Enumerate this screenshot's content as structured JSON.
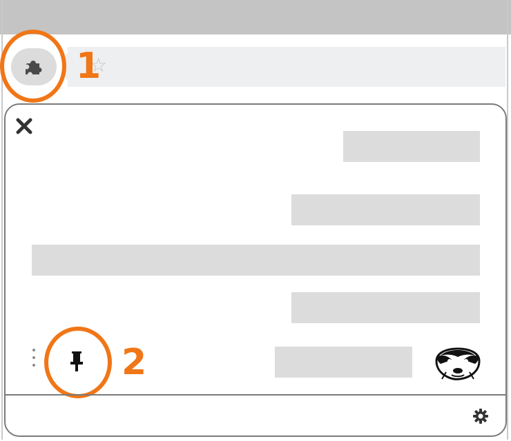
{
  "annotations": {
    "step1_label": "1",
    "step2_label": "2",
    "accent_color": "#f07617"
  },
  "toolbar": {
    "extensions_icon": "puzzle-icon",
    "bookmark_icon": "star-icon",
    "star_glyph": "☆"
  },
  "extensions_menu": {
    "close_icon": "close-icon",
    "item_count": 5,
    "pinned_extension": {
      "pin_icon": "pin-icon",
      "more_icon": "more-vertical-icon",
      "logo_icon": "badger-icon"
    },
    "footer_icon": "gear-icon"
  },
  "colors": {
    "title_bar": "#c4c4c4",
    "address_bar": "#eeeff1",
    "placeholder": "#dcdcdc",
    "border": "#7a7a7a"
  }
}
